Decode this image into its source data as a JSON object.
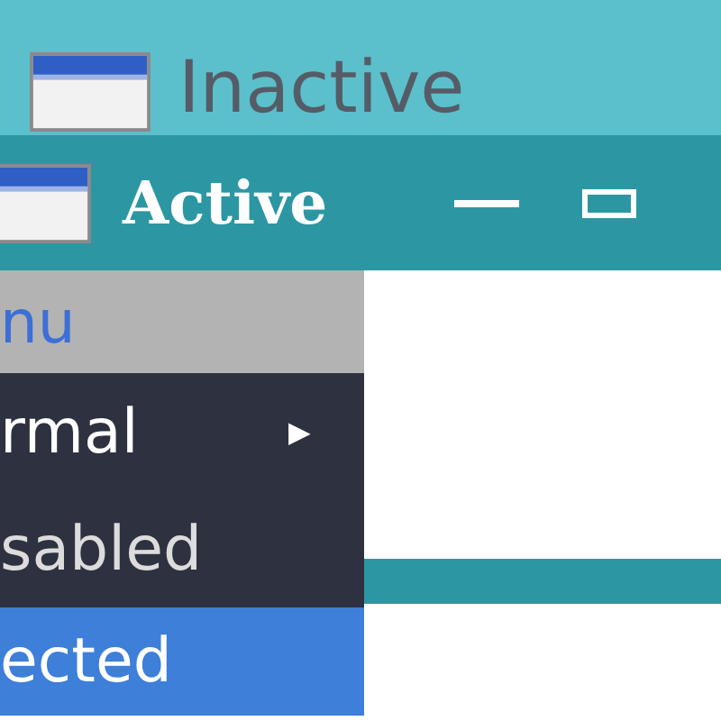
{
  "inactive_window": {
    "title": "Inactive"
  },
  "active_window": {
    "title": "Active"
  },
  "menu": {
    "title": "nu",
    "items": [
      {
        "label": "rmal",
        "kind": "submenu",
        "disabled": false,
        "selected": false
      },
      {
        "label": "sabled",
        "kind": "plain",
        "disabled": true,
        "selected": false
      },
      {
        "label": "ected",
        "kind": "plain",
        "disabled": false,
        "selected": true
      }
    ]
  },
  "submenu_arrow": "▶"
}
